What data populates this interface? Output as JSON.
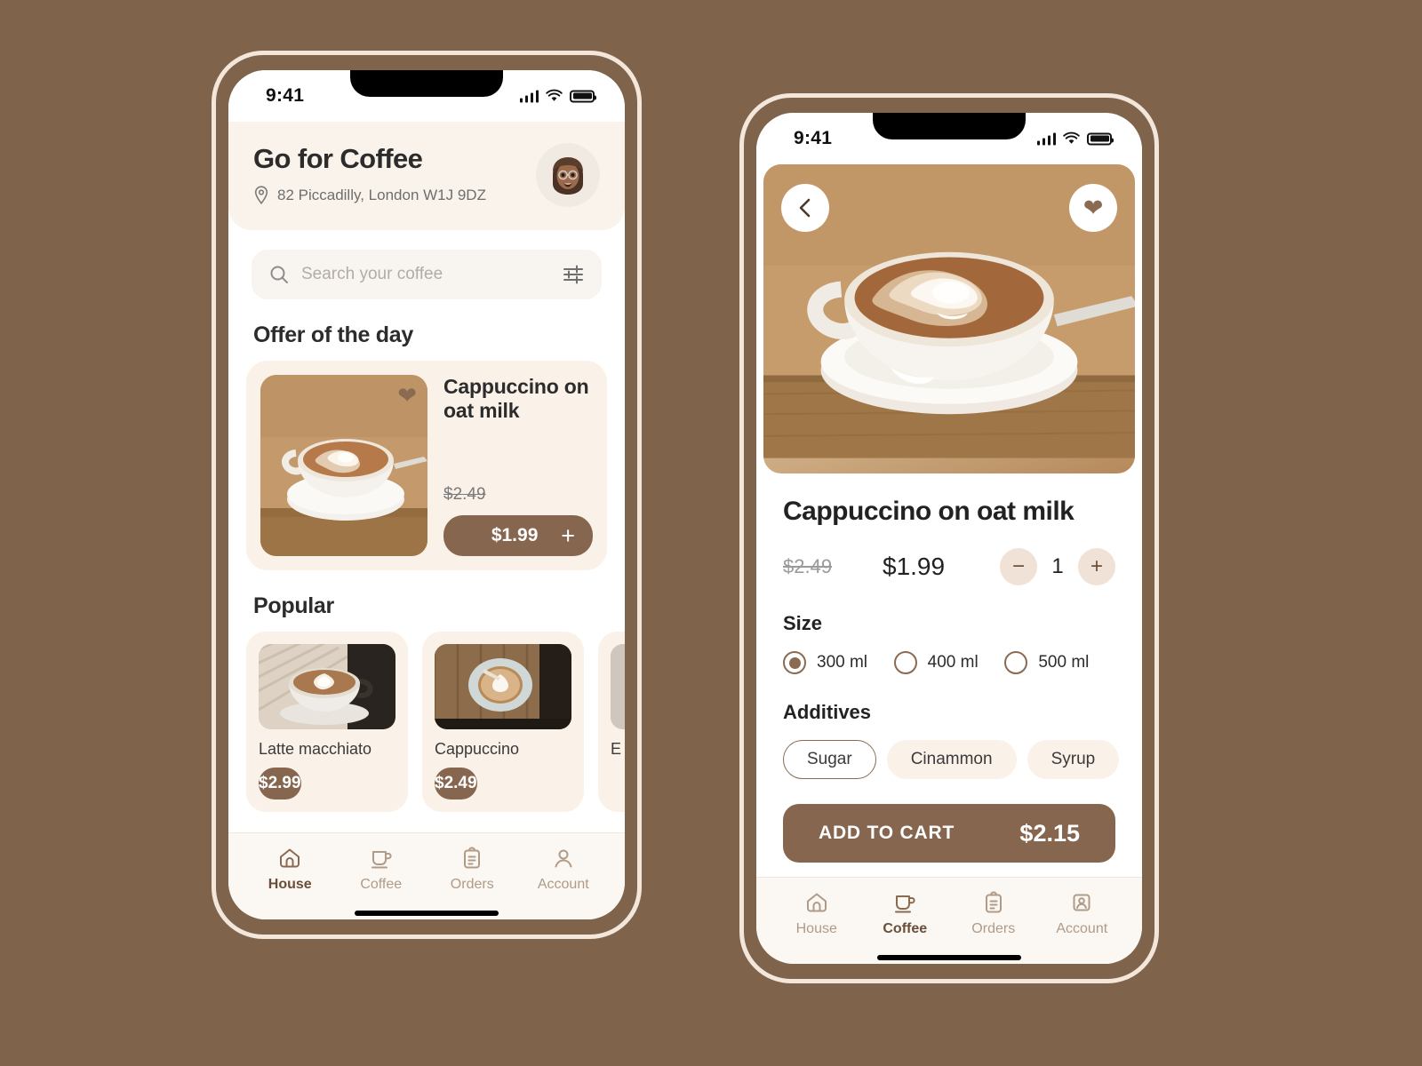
{
  "screens": {
    "home": {
      "status_bar": {
        "time": "9:41"
      },
      "header": {
        "title": "Go for Coffee",
        "address": "82 Piccadilly, London W1J 9DZ",
        "location_icon": "map-pin-icon",
        "avatar_icon": "user-avatar-memoji"
      },
      "search": {
        "placeholder": "Search your coffee",
        "search_icon": "search-icon",
        "filter_icon": "sliders-filter-icon"
      },
      "offer_section": {
        "title": "Offer of the day",
        "item": {
          "name": "Cappuccino on oat milk",
          "old_price": "$2.49",
          "price": "$1.99",
          "favorite_icon": "heart-filled-icon",
          "add_icon": "plus-icon"
        }
      },
      "popular_section": {
        "title": "Popular",
        "items": [
          {
            "name": "Latte macchiato",
            "price": "$2.99"
          },
          {
            "name": "Cappuccino",
            "price": "$2.49"
          },
          {
            "name": "E",
            "price": ""
          }
        ]
      },
      "tabbar": {
        "items": [
          {
            "label": "House",
            "icon": "home-icon",
            "active": true
          },
          {
            "label": "Coffee",
            "icon": "coffee-cup-icon",
            "active": false
          },
          {
            "label": "Orders",
            "icon": "clipboard-icon",
            "active": false
          },
          {
            "label": "Account",
            "icon": "person-icon",
            "active": false
          }
        ]
      }
    },
    "detail": {
      "status_bar": {
        "time": "9:41"
      },
      "hero": {
        "back_icon": "chevron-left-icon",
        "favorite_icon": "heart-filled-icon"
      },
      "product": {
        "name": "Cappuccino on oat milk",
        "old_price": "$2.49",
        "price": "$1.99",
        "quantity": "1",
        "decrease_icon": "minus-icon",
        "increase_icon": "plus-icon"
      },
      "size": {
        "label": "Size",
        "options": [
          {
            "label": "300 ml",
            "selected": true
          },
          {
            "label": "400 ml",
            "selected": false
          },
          {
            "label": "500 ml",
            "selected": false
          }
        ]
      },
      "additives": {
        "label": "Additives",
        "options": [
          {
            "label": "Sugar",
            "selected": true
          },
          {
            "label": "Cinammon",
            "selected": false
          },
          {
            "label": "Syrup",
            "selected": false
          }
        ]
      },
      "cart": {
        "label": "ADD TO CART",
        "total": "$2.15"
      },
      "tabbar": {
        "items": [
          {
            "label": "House",
            "icon": "home-icon",
            "active": false
          },
          {
            "label": "Coffee",
            "icon": "coffee-cup-icon",
            "active": true
          },
          {
            "label": "Orders",
            "icon": "clipboard-icon",
            "active": false
          },
          {
            "label": "Account",
            "icon": "person-card-icon",
            "active": false
          }
        ]
      }
    }
  },
  "colors": {
    "page_background": "#80634b",
    "accent_brown": "#86664f",
    "cream_card": "#faf1e9",
    "header_cream": "#faf3ec",
    "muted_text": "#b09b87",
    "active_tab": "#6b4e39",
    "stepper_bg": "#f0e2d6"
  }
}
